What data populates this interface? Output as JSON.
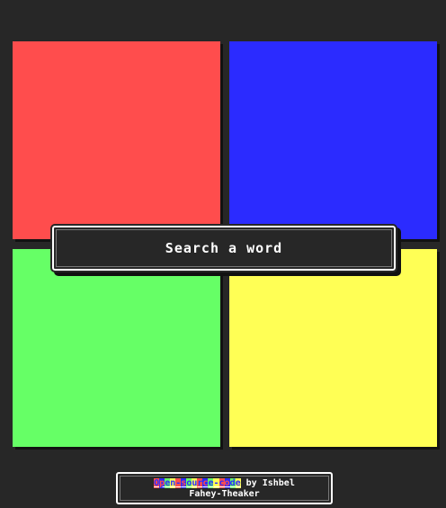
{
  "tiles": [
    {
      "id": "red",
      "color": "#ff4d4d"
    },
    {
      "id": "blue",
      "color": "#2b2bff"
    },
    {
      "id": "green",
      "color": "#66ff66"
    },
    {
      "id": "yellow",
      "color": "#ffff55"
    }
  ],
  "search": {
    "label": "Search a word"
  },
  "credit": {
    "link_text": "Open-source-code",
    "suffix": " by Ishbel",
    "author_line2": "Fahey-Theaker"
  }
}
